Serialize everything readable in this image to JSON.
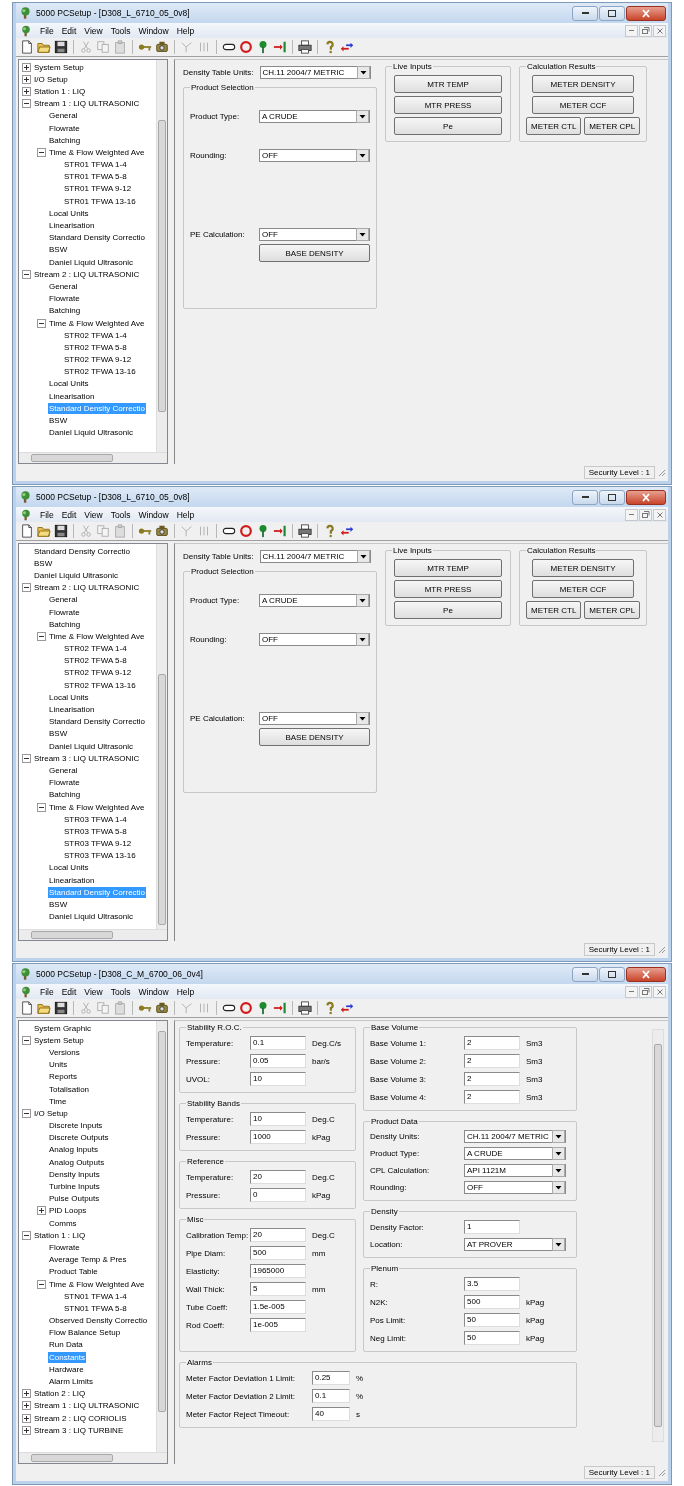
{
  "windows": [
    {
      "title": "5000 PCSetup - [D308_L_6710_05_0v8]",
      "menu": [
        "File",
        "Edit",
        "View",
        "Tools",
        "Window",
        "Help"
      ],
      "tree": [
        {
          "label": "System Setup",
          "expanded": false,
          "selected": false
        },
        {
          "label": "I/O Setup",
          "expanded": false,
          "selected": false
        },
        {
          "label": "Station 1 : LIQ",
          "expanded": false,
          "selected": false
        },
        {
          "label": "Stream 1 : LIQ ULTRASONIC",
          "expanded": true,
          "selected": false,
          "children": [
            {
              "label": "General",
              "selected": false
            },
            {
              "label": "Flowrate",
              "selected": false
            },
            {
              "label": "Batching",
              "selected": false
            },
            {
              "label": "Time & Flow Weighted Ave",
              "expanded": true,
              "selected": false,
              "children": [
                {
                  "label": "STR01 TFWA 1-4",
                  "selected": false
                },
                {
                  "label": "STR01 TFWA 5-8",
                  "selected": false
                },
                {
                  "label": "STR01 TFWA 9-12",
                  "selected": false
                },
                {
                  "label": "STR01 TFWA 13-16",
                  "selected": false
                }
              ]
            },
            {
              "label": "Local Units",
              "selected": false
            },
            {
              "label": "Linearisation",
              "selected": false
            },
            {
              "label": "Standard Density Correctio",
              "selected": false
            },
            {
              "label": "BSW",
              "selected": false
            },
            {
              "label": "Daniel Liquid Ultrasonic",
              "selected": false
            }
          ]
        },
        {
          "label": "Stream 2 : LIQ ULTRASONIC",
          "expanded": true,
          "selected": false,
          "children": [
            {
              "label": "General",
              "selected": false
            },
            {
              "label": "Flowrate",
              "selected": false
            },
            {
              "label": "Batching",
              "selected": false
            },
            {
              "label": "Time & Flow Weighted Ave",
              "expanded": true,
              "selected": false,
              "children": [
                {
                  "label": "STR02 TFWA 1-4",
                  "selected": false
                },
                {
                  "label": "STR02 TFWA 5-8",
                  "selected": false
                },
                {
                  "label": "STR02 TFWA 9-12",
                  "selected": false
                },
                {
                  "label": "STR02 TFWA 13-16",
                  "selected": false
                }
              ]
            },
            {
              "label": "Local Units",
              "selected": false
            },
            {
              "label": "Linearisation",
              "selected": false
            },
            {
              "label": "Standard Density Correctio",
              "selected": true
            },
            {
              "label": "BSW",
              "selected": false
            },
            {
              "label": "Daniel Liquid Ultrasonic",
              "selected": false
            }
          ]
        }
      ],
      "panel": {
        "kind": "density",
        "units": {
          "label": "Density Table Units:",
          "value": "CH.11 2004/7 METRIC"
        },
        "product_selection": {
          "title": "Product Selection",
          "rows": [
            {
              "label": "Product Type:",
              "value": "A CRUDE"
            },
            {
              "label": "Rounding:",
              "value": "OFF"
            },
            {
              "label": "PE Calculation:",
              "value": "OFF"
            }
          ],
          "button": "BASE DENSITY"
        },
        "live_inputs": {
          "title": "Live Inputs",
          "buttons": [
            "MTR TEMP",
            "MTR PRESS",
            "Pe"
          ]
        },
        "calculation_results": {
          "title": "Calculation Results",
          "buttons": [
            "METER DENSITY",
            "METER CCF",
            "METER CTL",
            "METER CPL"
          ]
        }
      },
      "status": "Security Level : 1"
    },
    {
      "title": "5000 PCSetup - [D308_L_6710_05_0v8]",
      "menu": [
        "File",
        "Edit",
        "View",
        "Tools",
        "Window",
        "Help"
      ],
      "tree": [
        {
          "children": [
            {
              "label": "Standard Density Correctio",
              "selected": false
            },
            {
              "label": "BSW",
              "selected": false
            },
            {
              "label": "Daniel Liquid Ultrasonic",
              "selected": false
            }
          ]
        },
        {
          "label": "Stream 2 : LIQ ULTRASONIC",
          "expanded": true,
          "selected": false,
          "children": [
            {
              "label": "General",
              "selected": false
            },
            {
              "label": "Flowrate",
              "selected": false
            },
            {
              "label": "Batching",
              "selected": false
            },
            {
              "label": "Time & Flow Weighted Ave",
              "expanded": true,
              "selected": false,
              "children": [
                {
                  "label": "STR02 TFWA 1-4",
                  "selected": false
                },
                {
                  "label": "STR02 TFWA 5-8",
                  "selected": false
                },
                {
                  "label": "STR02 TFWA 9-12",
                  "selected": false
                },
                {
                  "label": "STR02 TFWA 13-16",
                  "selected": false
                }
              ]
            },
            {
              "label": "Local Units",
              "selected": false
            },
            {
              "label": "Linearisation",
              "selected": false
            },
            {
              "label": "Standard Density Correctio",
              "selected": false
            },
            {
              "label": "BSW",
              "selected": false
            },
            {
              "label": "Daniel Liquid Ultrasonic",
              "selected": false
            }
          ]
        },
        {
          "label": "Stream 3 : LIQ ULTRASONIC",
          "expanded": true,
          "selected": false,
          "children": [
            {
              "label": "General",
              "selected": false
            },
            {
              "label": "Flowrate",
              "selected": false
            },
            {
              "label": "Batching",
              "selected": false
            },
            {
              "label": "Time & Flow Weighted Ave",
              "expanded": true,
              "selected": false,
              "children": [
                {
                  "label": "STR03 TFWA 1-4",
                  "selected": false
                },
                {
                  "label": "STR03 TFWA 5-8",
                  "selected": false
                },
                {
                  "label": "STR03 TFWA 9-12",
                  "selected": false
                },
                {
                  "label": "STR03 TFWA 13-16",
                  "selected": false
                }
              ]
            },
            {
              "label": "Local Units",
              "selected": false
            },
            {
              "label": "Linearisation",
              "selected": false
            },
            {
              "label": "Standard Density Correctio",
              "selected": true
            },
            {
              "label": "BSW",
              "selected": false
            },
            {
              "label": "Daniel Liquid Ultrasonic",
              "selected": false
            }
          ]
        }
      ],
      "panel": {
        "kind": "density",
        "units": {
          "label": "Density Table Units:",
          "value": "CH.11 2004/7 METRIC"
        },
        "product_selection": {
          "title": "Product Selection",
          "rows": [
            {
              "label": "Product Type:",
              "value": "A CRUDE"
            },
            {
              "label": "Rounding:",
              "value": "OFF"
            },
            {
              "label": "PE Calculation:",
              "value": "OFF"
            }
          ],
          "button": "BASE DENSITY"
        },
        "live_inputs": {
          "title": "Live Inputs",
          "buttons": [
            "MTR TEMP",
            "MTR PRESS",
            "Pe"
          ]
        },
        "calculation_results": {
          "title": "Calculation Results",
          "buttons": [
            "METER DENSITY",
            "METER CCF",
            "METER CTL",
            "METER CPL"
          ]
        }
      },
      "status": "Security Level : 1"
    },
    {
      "title": "5000 PCSetup - [D308_C_M_6700_06_0v4]",
      "menu": [
        "File",
        "Edit",
        "View",
        "Tools",
        "Window",
        "Help"
      ],
      "tree": [
        {
          "label": "System Graphic",
          "selected": false
        },
        {
          "label": "System Setup",
          "expanded": true,
          "selected": false,
          "children": [
            {
              "label": "Versions",
              "selected": false
            },
            {
              "label": "Units",
              "selected": false
            },
            {
              "label": "Reports",
              "selected": false
            },
            {
              "label": "Totalisation",
              "selected": false
            },
            {
              "label": "Time",
              "selected": false
            }
          ]
        },
        {
          "label": "I/O Setup",
          "expanded": true,
          "selected": false,
          "children": [
            {
              "label": "Discrete Inputs",
              "selected": false
            },
            {
              "label": "Discrete Outputs",
              "selected": false
            },
            {
              "label": "Analog Inputs",
              "selected": false
            },
            {
              "label": "Analog Outputs",
              "selected": false
            },
            {
              "label": "Density Inputs",
              "selected": false
            },
            {
              "label": "Turbine Inputs",
              "selected": false
            },
            {
              "label": "Pulse Outputs",
              "selected": false
            },
            {
              "label": "PID Loops",
              "expanded": false,
              "selected": false
            },
            {
              "label": "Comms",
              "selected": false
            }
          ]
        },
        {
          "label": "Station 1 : LIQ",
          "expanded": true,
          "selected": false,
          "children": [
            {
              "label": "Flowrate",
              "selected": false
            },
            {
              "label": "Average Temp & Pres",
              "selected": false
            },
            {
              "label": "Product Table",
              "selected": false
            },
            {
              "label": "Time & Flow Weighted Ave",
              "expanded": true,
              "selected": false,
              "children": [
                {
                  "label": "STN01 TFWA 1-4",
                  "selected": false
                },
                {
                  "label": "STN01 TFWA 5-8",
                  "selected": false
                }
              ]
            },
            {
              "label": "Observed Density Correctio",
              "selected": false
            },
            {
              "label": "Flow Balance Setup",
              "selected": false
            },
            {
              "label": "Run Data",
              "selected": false
            },
            {
              "label": "Constants",
              "selected": true
            },
            {
              "label": "Hardware",
              "selected": false
            },
            {
              "label": "Alarm Limits",
              "selected": false
            }
          ]
        },
        {
          "label": "Station 2 : LIQ",
          "expanded": false,
          "selected": false
        },
        {
          "label": "Stream 1 : LIQ ULTRASONIC",
          "expanded": false,
          "selected": false
        },
        {
          "label": "Stream 2 : LIQ CORIOLIS",
          "expanded": false,
          "selected": false
        },
        {
          "label": "Stream 3 : LIQ TURBINE",
          "expanded": false,
          "selected": false
        }
      ],
      "panel": {
        "kind": "constants",
        "columns": [
          [
            {
              "title": "Stability R.O.C.",
              "rows": [
                {
                  "kind": "text",
                  "label": "Temperature:",
                  "value": "0.1",
                  "unit": "Deg.C/s"
                },
                {
                  "kind": "text",
                  "label": "Pressure:",
                  "value": "0.05",
                  "unit": "bar/s"
                },
                {
                  "kind": "text",
                  "label": "UVOL:",
                  "value": "10"
                }
              ]
            },
            {
              "title": "Stability Bands",
              "rows": [
                {
                  "kind": "text",
                  "label": "Temperature:",
                  "value": "10",
                  "unit": "Deg.C"
                },
                {
                  "kind": "text",
                  "label": "Pressure:",
                  "value": "1000",
                  "unit": "kPag"
                }
              ]
            },
            {
              "title": "Reference",
              "rows": [
                {
                  "kind": "text",
                  "label": "Temperature:",
                  "value": "20",
                  "unit": "Deg.C"
                },
                {
                  "kind": "text",
                  "label": "Pressure:",
                  "value": "0",
                  "unit": "kPag"
                }
              ]
            },
            {
              "title": "Misc",
              "rows": [
                {
                  "kind": "text",
                  "label": "Calibration Temp:",
                  "value": "20",
                  "unit": "Deg.C"
                },
                {
                  "kind": "text",
                  "label": "Pipe Diam:",
                  "value": "500",
                  "unit": "mm"
                },
                {
                  "kind": "text",
                  "label": "Elasticity:",
                  "value": "1965000"
                },
                {
                  "kind": "text",
                  "label": "Wall Thick:",
                  "value": "5",
                  "unit": "mm"
                },
                {
                  "kind": "text",
                  "label": "Tube Coeff:",
                  "value": "1.5e-005"
                },
                {
                  "kind": "text",
                  "label": "Rod Coeff:",
                  "value": "1e-005"
                }
              ]
            }
          ],
          [
            {
              "title": "Base Volume",
              "rows": [
                {
                  "kind": "text",
                  "label": "Base Volume 1:",
                  "value": "2",
                  "unit": "Sm3"
                },
                {
                  "kind": "text",
                  "label": "Base Volume 2:",
                  "value": "2",
                  "unit": "Sm3"
                },
                {
                  "kind": "text",
                  "label": "Base Volume 3:",
                  "value": "2",
                  "unit": "Sm3"
                },
                {
                  "kind": "text",
                  "label": "Base Volume 4:",
                  "value": "2",
                  "unit": "Sm3"
                }
              ]
            },
            {
              "title": "Product Data",
              "rows": [
                {
                  "kind": "select",
                  "label": "Density Units:",
                  "value": "CH.11 2004/7 METRIC"
                },
                {
                  "kind": "select",
                  "label": "Product Type:",
                  "value": "A CRUDE"
                },
                {
                  "kind": "select",
                  "label": "CPL Calculation:",
                  "value": "API 1121M"
                },
                {
                  "kind": "select",
                  "label": "Rounding:",
                  "value": "OFF"
                }
              ]
            },
            {
              "title": "Density",
              "rows": [
                {
                  "kind": "text",
                  "label": "Density Factor:",
                  "value": "1"
                },
                {
                  "kind": "select",
                  "label": "Location:",
                  "value": "AT PROVER"
                }
              ]
            },
            {
              "title": "Plenum",
              "rows": [
                {
                  "kind": "text",
                  "label": "R:",
                  "value": "3.5"
                },
                {
                  "kind": "text",
                  "label": "N2K:",
                  "value": "500",
                  "unit": "kPag"
                },
                {
                  "kind": "text",
                  "label": "Pos Limit:",
                  "value": "50",
                  "unit": "kPag"
                },
                {
                  "kind": "text",
                  "label": "Neg Limit:",
                  "value": "50",
                  "unit": "kPag"
                }
              ]
            }
          ]
        ],
        "bottom": [
          {
            "title": "Alarms",
            "rows": [
              {
                "kind": "text",
                "label": "Meter Factor Deviation 1 Limit:",
                "value": "0.25",
                "unit": "%"
              },
              {
                "kind": "text",
                "label": "Meter Factor Deviation 2 Limit:",
                "value": "0.1",
                "unit": "%"
              },
              {
                "kind": "text",
                "label": "Meter Factor Reject Timeout:",
                "value": "40",
                "unit": "s"
              }
            ]
          }
        ]
      },
      "status": "Security Level : 1"
    }
  ]
}
